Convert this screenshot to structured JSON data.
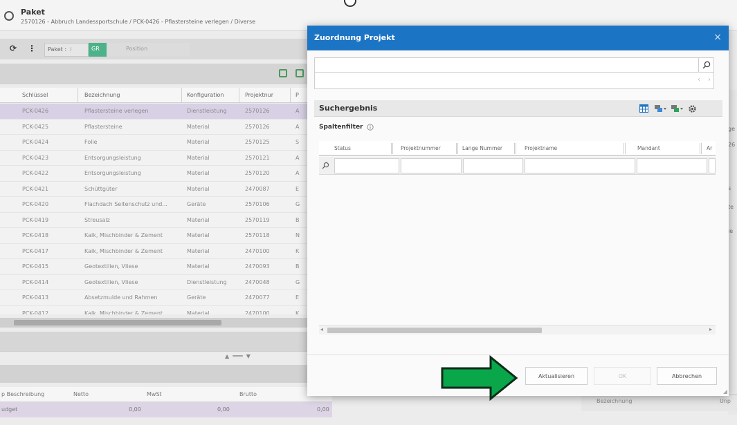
{
  "app": {
    "title": "Paket",
    "subtitle": "2570126 - Abbruch Landessportschule / PCK-0426 - Pflastersteine verlegen / Diverse",
    "toolbar": {
      "paket_label": "Paket :",
      "paket_value": "GR",
      "position_label": "Position"
    }
  },
  "grid": {
    "columns": [
      "Schlüssel",
      "Bezeichnung",
      "Konfiguration",
      "Projektnur",
      "P"
    ],
    "rows": [
      {
        "key": "PCK-0426",
        "name": "Pflastersteine verlegen",
        "config": "Dienstleistung",
        "project": "2570126",
        "p": "A",
        "selected": true
      },
      {
        "key": "PCK-0425",
        "name": "Pflastersteine",
        "config": "Material",
        "project": "2570126",
        "p": "A"
      },
      {
        "key": "PCK-0424",
        "name": "Folie",
        "config": "Material",
        "project": "2570125",
        "p": "S"
      },
      {
        "key": "PCK-0423",
        "name": "Entsorgungsleistung",
        "config": "Material",
        "project": "2570121",
        "p": "A"
      },
      {
        "key": "PCK-0422",
        "name": "Entsorgungsleistung",
        "config": "Material",
        "project": "2570120",
        "p": "A"
      },
      {
        "key": "PCK-0421",
        "name": "Schüttgüter",
        "config": "Material",
        "project": "2470087",
        "p": "E"
      },
      {
        "key": "PCK-0420",
        "name": "Flachdach Seitenschutz und...",
        "config": "Geräte",
        "project": "2570106",
        "p": "G"
      },
      {
        "key": "PCK-0419",
        "name": "Streusalz",
        "config": "Material",
        "project": "2570119",
        "p": "B"
      },
      {
        "key": "PCK-0418",
        "name": "Kalk, Mischbinder & Zement",
        "config": "Material",
        "project": "2570118",
        "p": "N"
      },
      {
        "key": "PCK-0417",
        "name": "Kalk, Mischbinder & Zement",
        "config": "Material",
        "project": "2470100",
        "p": "K"
      },
      {
        "key": "PCK-0415",
        "name": "Geotextilien, Vliese",
        "config": "Material",
        "project": "2470093",
        "p": "B"
      },
      {
        "key": "PCK-0414",
        "name": "Geotextilien, Vliese",
        "config": "Dienstleistung",
        "project": "2470048",
        "p": "G"
      },
      {
        "key": "PCK-0413",
        "name": "Absetzmulde und Rahmen",
        "config": "Geräte",
        "project": "2470077",
        "p": "E"
      },
      {
        "key": "PCK-0412",
        "name": "Kalk, Mischbinder & Zement",
        "config": "Material",
        "project": "2470100",
        "p": "K"
      }
    ]
  },
  "bottom_grid": {
    "columns": [
      "p Beschreibung",
      "Netto",
      "MwSt",
      "Brutto"
    ],
    "row": {
      "label": "udget",
      "netto": "0,00",
      "mwst": "0,00",
      "brutto": "0,00"
    }
  },
  "right_fragments": [
    "ge",
    "26",
    "s",
    "te",
    "ie"
  ],
  "right_bottom": {
    "label": "Bezeichnung",
    "label2": "Unp"
  },
  "modal": {
    "title": "Zuordnung Projekt",
    "close_glyph": "×",
    "search": {
      "value": "",
      "placeholder": ""
    },
    "pager_prev": "‹",
    "pager_next": "›",
    "results_title": "Suchergebnis",
    "column_filter_label": "Spaltenfilter",
    "columns": [
      "Status",
      "Projektnummer",
      "Lange Nummer",
      "Projektname",
      "Mandant",
      "Ar"
    ],
    "buttons": {
      "refresh": "Aktualisieren",
      "ok": "OK",
      "cancel": "Abbrechen"
    }
  },
  "colors": {
    "modal_header": "#1c74c4",
    "annotation_arrow": "#0aa64a",
    "selected_row": "#d8d0e4",
    "green_tag": "#4db28a"
  },
  "icons": [
    "search-icon",
    "close-icon",
    "table-icon",
    "settings-gear-icon",
    "info-icon",
    "add-row-icon"
  ]
}
